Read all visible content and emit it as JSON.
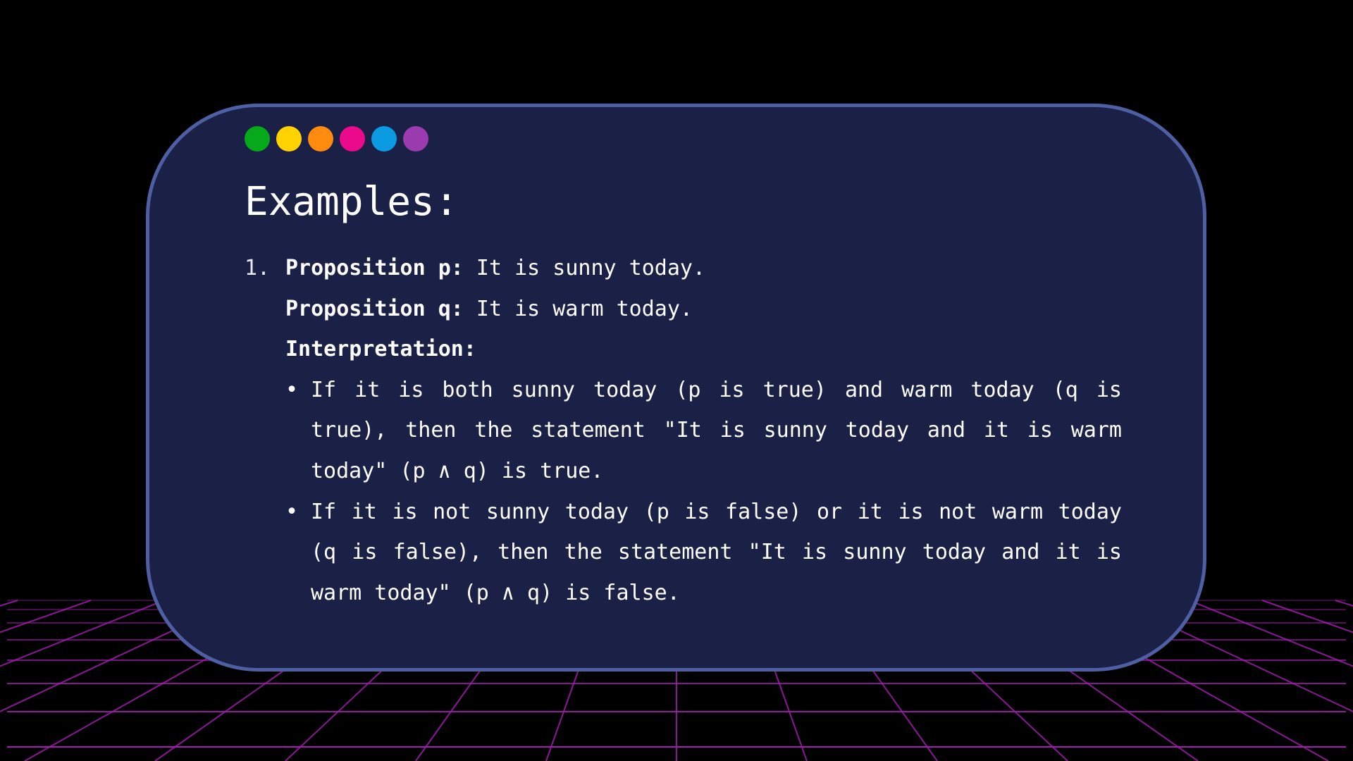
{
  "colors": {
    "background": "#000000",
    "card_fill": "#1b2047",
    "card_border": "#4e5fa3",
    "grid_line": "#a21caf",
    "text": "#ffffff"
  },
  "dots": [
    {
      "name": "green-dot",
      "color": "#06a919"
    },
    {
      "name": "yellow-dot",
      "color": "#ffd200"
    },
    {
      "name": "orange-dot",
      "color": "#ff8c0f"
    },
    {
      "name": "pink-dot",
      "color": "#ec0a8c"
    },
    {
      "name": "blue-dot",
      "color": "#0b9be3"
    },
    {
      "name": "purple-dot",
      "color": "#9a3cb0"
    }
  ],
  "title": "Examples:",
  "example": {
    "number": "1.",
    "prop_p_label": "Proposition p:",
    "prop_p_text": " It is sunny today.",
    "prop_q_label": "Proposition q:",
    "prop_q_text": " It is warm today.",
    "interpretation_label": "Interpretation:",
    "bullet_mark": "•",
    "bullets": [
      "If it is both sunny today (p is true) and warm today (q is true), then the statement \"It is sunny today and it is warm today\" (p ∧ q) is true.",
      "If it is not sunny today (p is false) or it is not warm today (q is false), then the statement \"It is sunny today and it is warm today\" (p ∧ q) is false."
    ]
  }
}
